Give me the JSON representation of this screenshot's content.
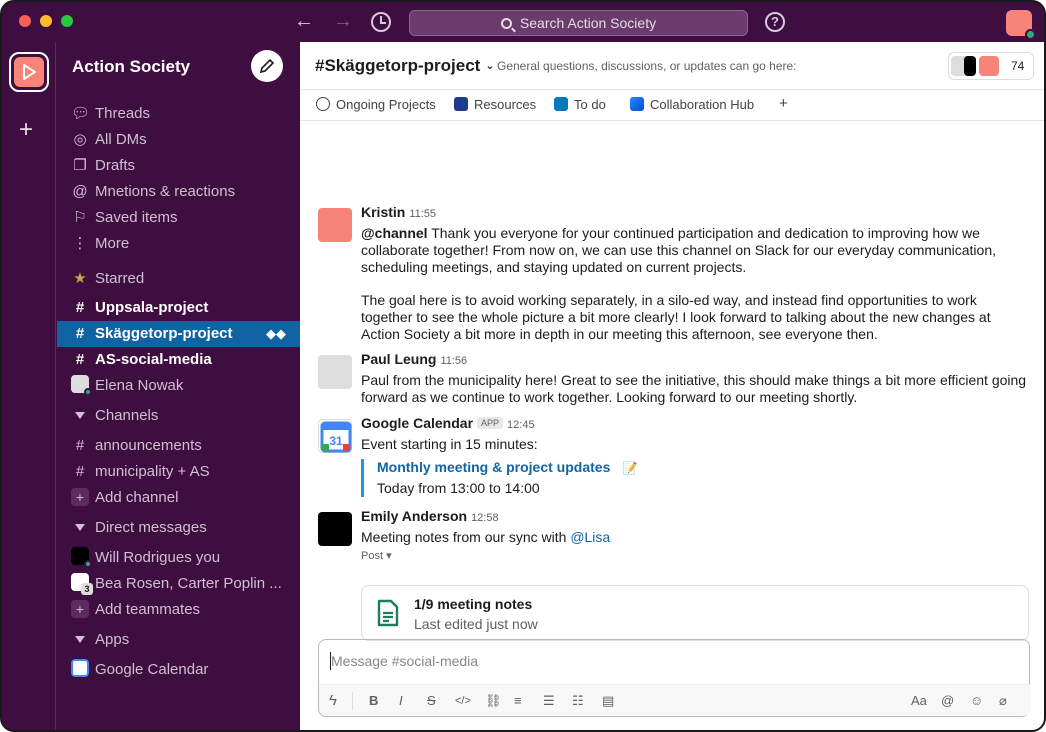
{
  "titlebar": {
    "search_placeholder": "Search Action Society",
    "help_label": "?"
  },
  "workspace": {
    "name": "Action Society",
    "add_label": "+"
  },
  "sidebar": {
    "nav": [
      {
        "label": "Threads",
        "icon": "threads-icon"
      },
      {
        "label": "All DMs",
        "icon": "dms-icon"
      },
      {
        "label": "Drafts",
        "icon": "drafts-icon"
      },
      {
        "label": "Mnetions & reactions",
        "icon": "at-icon"
      },
      {
        "label": "Saved items",
        "icon": "bookmark-icon"
      },
      {
        "label": "More",
        "icon": "more-icon"
      }
    ],
    "starred_label": "Starred",
    "starred": [
      {
        "label": "Uppsala-project",
        "prefix": "#"
      },
      {
        "label": "Skäggetorp-project",
        "prefix": "#"
      },
      {
        "label": "AS-social-media",
        "prefix": "#"
      },
      {
        "label": "Elena Nowak"
      }
    ],
    "channels_label": "Channels",
    "channels": [
      {
        "label": "announcements",
        "prefix": "#"
      },
      {
        "label": "municipality + AS",
        "prefix": "#"
      }
    ],
    "add_channel": "Add channel",
    "dms_label": "Direct messages",
    "dms": [
      {
        "label": "Will Rodrigues  you"
      },
      {
        "label": "Bea Rosen, Carter Poplin ...",
        "count": "3"
      }
    ],
    "add_teammates": "Add teammates",
    "apps_label": "Apps",
    "apps": [
      {
        "label": "Google Calendar"
      }
    ]
  },
  "channel": {
    "title": "#Skäggetorp-project",
    "topic": "General questions, discussions, or updates can go here:",
    "member_count": "74",
    "tabs": [
      {
        "label": "Ongoing Projects"
      },
      {
        "label": "Resources"
      },
      {
        "label": "To do"
      },
      {
        "label": "Collaboration Hub"
      }
    ],
    "add_tab": "+"
  },
  "messages": [
    {
      "author": "Kristin",
      "time": "11:55",
      "mention": "@channel",
      "text1": " Thank you everyone for your continued participation and dedication to improving how we collaborate together! From now on, we can use this channel on Slack for our everyday communication, scheduling meetings, and staying updated on current projects.",
      "text2": "The goal here is to avoid working separately, in a silo-ed way, and instead find opportunities to work together to see the whole picture a bit more clearly! I look forward to talking about the new changes at Action Society a bit more in depth in our meeting this afternoon, see everyone then."
    },
    {
      "author": "Paul Leung",
      "time": "11:56",
      "text1": "Paul from the municipality here! Great to see the initiative, this should make things a bit more efficient going forward as we continue to work together. Looking forward to our meeting shortly."
    },
    {
      "author": "Google Calendar",
      "badge": "APP",
      "time": "12:45",
      "text1": "Event starting in 15 minutes:",
      "event_title": "Monthly meeting & project updates",
      "event_emoji": "📝",
      "event_time": "Today from 13:00 to 14:00"
    },
    {
      "author": "Emily Anderson",
      "time": "12:58",
      "text1": "Meeting notes from our sync with ",
      "mention": "@Lisa",
      "post_label": "Post ▾",
      "post_title": "1/9 meeting notes",
      "post_sub": "Last edited just now"
    }
  ],
  "composer": {
    "placeholder": "Message #social-media"
  },
  "colors": {
    "sidebar_bg": "#3f0e40",
    "active_item": "#1164a3",
    "brand_coral": "#f88379",
    "link": "#1264a3",
    "online": "#2bac76"
  }
}
